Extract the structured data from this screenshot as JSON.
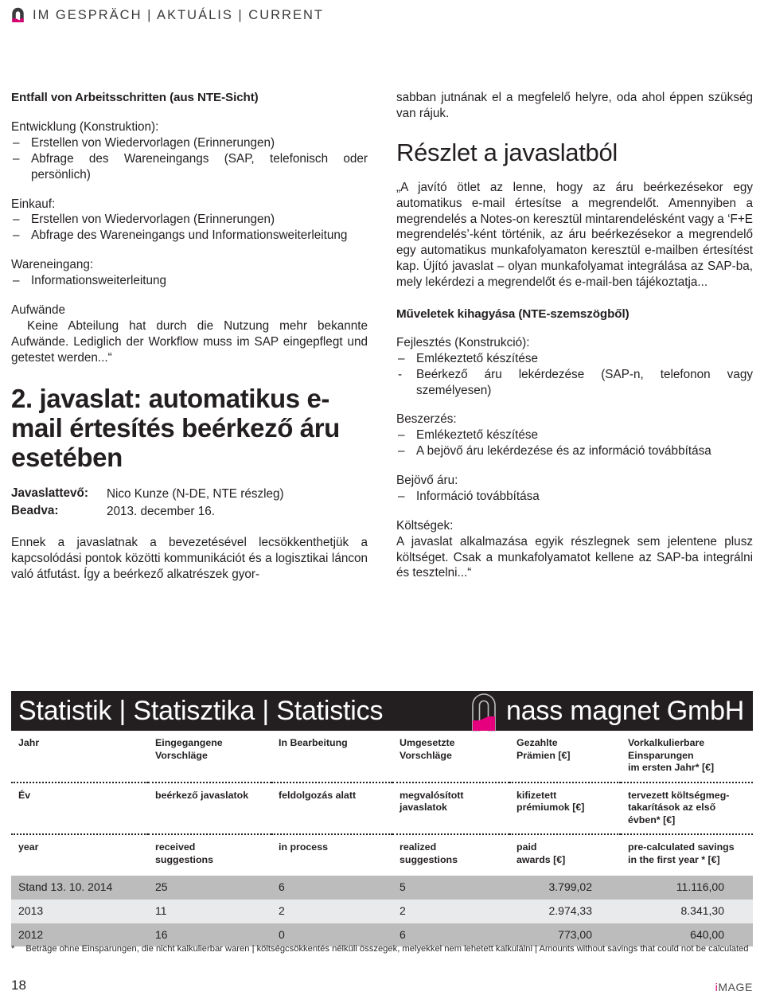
{
  "runhead": {
    "text": "IM GESPRÄCH | AKTUÁLIS | CURRENT",
    "logo_icon": "magnet-logo-icon"
  },
  "colors": {
    "magenta": "#d6006f",
    "dark": "#231f20",
    "row_shade": "#bcbcbc",
    "row_light": "#e9eaeb"
  },
  "left_column": {
    "heading": "Entfall von Arbeitsschritten (aus NTE-Sicht)",
    "groups": [
      {
        "label": "Entwicklung (Konstruktion):",
        "items": [
          "Erstellen von Wiedervorlagen (Erinnerungen)",
          "Abfrage des Wareneingangs (SAP, telefonisch oder persönlich)"
        ]
      },
      {
        "label": "Einkauf:",
        "items": [
          "Erstellen von Wiedervorlagen (Erinnerungen)",
          "Abfrage des Wareneingangs und Informationsweiterleitung"
        ]
      },
      {
        "label": "Wareneingang:",
        "items": [
          "Informationsweiterleitung"
        ]
      }
    ],
    "aufwaende_label": "Aufwände",
    "aufwaende_text": "Keine Abteilung hat durch die Nutzung mehr bekannte Aufwände. Lediglich der Workflow muss im SAP eingepflegt und getestet werden...“",
    "big_heading": "2. javaslat: automatikus e-mail értesítés beérkező áru esetében",
    "meta": [
      {
        "label": "Javaslattevő:",
        "value": "Nico Kunze (N-DE, NTE részleg)"
      },
      {
        "label": "Beadva:",
        "value": "2013. december 16."
      }
    ],
    "closing_paragraph": "Ennek a javaslatnak a bevezetésével lecsökkenthetjük a kapcsolódási pontok közötti kommunikációt és a logisztikai láncon való átfutást. Így a beérkező alkatrészek gyor-"
  },
  "right_column": {
    "continuation": "sabban jutnának el a megfelelő helyre, oda ahol éppen szükség van rájuk.",
    "heading": "Részlet a javaslatból",
    "quote": "„A javító ötlet az lenne, hogy az áru beérkezésekor egy automatikus e-mail értesítse a megrendelőt. Amennyiben a megrendelés a Notes-on keresztül mintarendelésként vagy a ‘F+E megrendelés’-ként történik, az áru beérkezésekor a megrendelő egy automatikus munkafolyamaton keresztül e-mailben értesítést kap. Újító javaslat – olyan munkafolyamat integrálása az SAP-ba, mely lekérdezi a megrendelőt és e-mail-ben tájékoztatja...",
    "subheading": "Műveletek kihagyása (NTE-szemszögből)",
    "groups": [
      {
        "label": "Fejlesztés (Konstrukció):",
        "items": [
          "Emlékeztető készítése",
          "Beérkező áru lekérdezése (SAP-n, telefonon vagy személyesen)"
        ]
      },
      {
        "label": "Beszerzés:",
        "items": [
          "Emlékeztető készítése",
          "A bejövő áru lekérdezése és az információ továbbítása"
        ]
      },
      {
        "label": "Bejövő áru:",
        "items": [
          "Információ továbbítása"
        ]
      }
    ],
    "costs_label": "Költségek:",
    "costs_text": "A javaslat alkalmazása egyik részlegnek sem jelentene plusz költséget. Csak a munkafolyamatot kellene az SAP-ba integrálni és tesztelni...“"
  },
  "stat_bar": {
    "title": "Statistik | Statisztika | Statistics",
    "brand": "nass magnet GmbH",
    "logo_icon": "magnet-logo-icon"
  },
  "stat_table": {
    "header_rows": [
      [
        "Jahr",
        "Eingegangene\nVorschläge",
        "In Bearbeitung",
        "Umgesetzte\nVorschläge",
        "Gezahlte\nPrämien [€]",
        "Vorkalkulierbare\nEinsparungen\nim ersten Jahr* [€]"
      ],
      [
        "Év",
        "beérkező javaslatok",
        "feldolgozás alatt",
        "megvalósított\njavaslatok",
        "kifizetett\nprémiumok [€]",
        "tervezett költségmeg-\ntakarítások az első\névben* [€]"
      ],
      [
        "year",
        "received\nsuggestions",
        "in process",
        "realized\nsuggestions",
        "paid\nawards [€]",
        "pre-calculated savings\nin the first year * [€]"
      ]
    ],
    "rows": [
      {
        "year": "Stand 13. 10. 2014",
        "received": "25",
        "in_process": "6",
        "realized": "5",
        "awards": "3.799,02",
        "savings": "11.116,00"
      },
      {
        "year": "2013",
        "received": "11",
        "in_process": "2",
        "realized": "2",
        "awards": "2.974,33",
        "savings": "8.341,30"
      },
      {
        "year": "2012",
        "received": "16",
        "in_process": "0",
        "realized": "6",
        "awards": "773,00",
        "savings": "640,00"
      }
    ]
  },
  "footnote": {
    "star": "*",
    "text": "Beträge ohne Einsparungen, die nicht kalkulierbar waren | költségcsökkentés nélküli összegek, melyekkel nem lehetett kalkulálni | Amounts without savings that could not be calculated"
  },
  "page_foot": {
    "page_number": "18",
    "magazine_i": "i",
    "magazine_rest": "MAGE"
  }
}
